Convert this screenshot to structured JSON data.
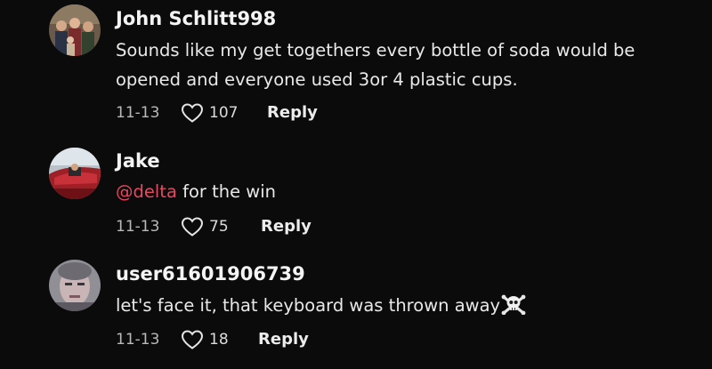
{
  "comments": [
    {
      "username": "John Schlitt998",
      "text": "Sounds like my get togethers every bottle of soda would be opened and everyone used 3or 4 plastic cups.",
      "date": "11-13",
      "likes": "107",
      "reply_label": "Reply"
    },
    {
      "username": "Jake",
      "mention": "@delta",
      "text": " for the win",
      "date": "11-13",
      "likes": "75",
      "reply_label": "Reply"
    },
    {
      "username": "user61601906739",
      "text": "let's face it, that keyboard was thrown away",
      "emoji": "skull-and-crossbones-icon",
      "date": "11-13",
      "likes": "18",
      "reply_label": "Reply"
    }
  ],
  "colors": {
    "background": "#0b0b0c",
    "mention": "#e5485f",
    "meta": "#b9b9bb"
  }
}
